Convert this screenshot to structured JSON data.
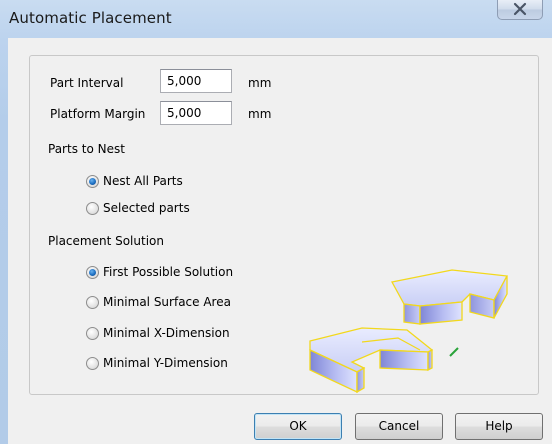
{
  "window": {
    "title": "Automatic Placement"
  },
  "fields": {
    "part_interval": {
      "label": "Part Interval",
      "value": "5,000",
      "unit": "mm"
    },
    "platform_margin": {
      "label": "Platform Margin",
      "value": "5,000",
      "unit": "mm"
    }
  },
  "parts_to_nest": {
    "heading": "Parts to Nest",
    "options": [
      {
        "label": "Nest All Parts",
        "checked": true
      },
      {
        "label": "Selected parts",
        "checked": false
      }
    ]
  },
  "placement_solution": {
    "heading": "Placement Solution",
    "options": [
      {
        "label": "First Possible Solution",
        "checked": true
      },
      {
        "label": "Minimal Surface Area",
        "checked": false
      },
      {
        "label": "Minimal X-Dimension",
        "checked": false
      },
      {
        "label": "Minimal Y-Dimension",
        "checked": false
      }
    ]
  },
  "buttons": {
    "ok": "OK",
    "cancel": "Cancel",
    "help": "Help"
  },
  "colors": {
    "titlebar": "#bcd3ee",
    "client": "#f0f0f0",
    "part_fill": "#b8bff0",
    "part_outline": "#f2d81c",
    "selected_radio": "#1d6fc2"
  },
  "icons": {
    "close": "close-x-icon",
    "illustration": "nested-parts-illustration"
  }
}
